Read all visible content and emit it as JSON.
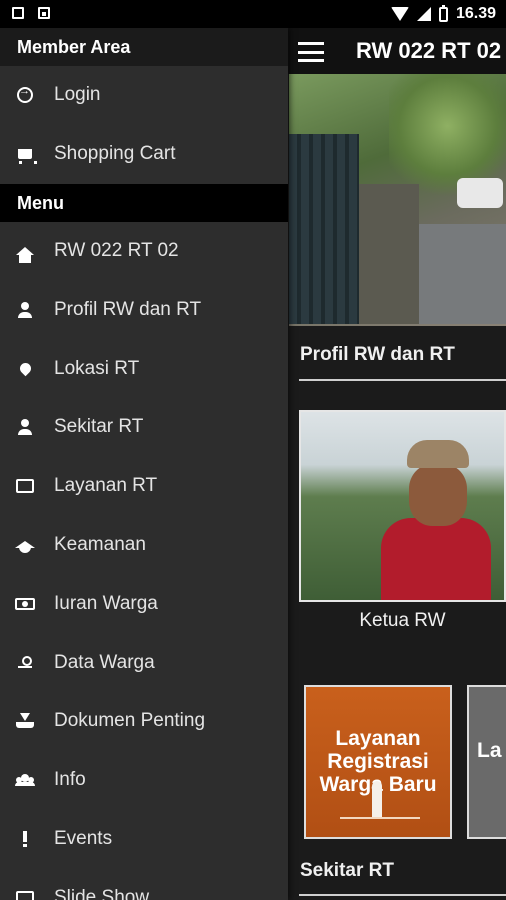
{
  "status_bar": {
    "time": "16.39"
  },
  "toolbar": {
    "title": "RW 022 RT 02"
  },
  "drawer": {
    "member_header": "Member Area",
    "member_items": [
      {
        "label": "Login",
        "icon": "login-icon"
      },
      {
        "label": "Shopping Cart",
        "icon": "cart-icon"
      }
    ],
    "menu_header": "Menu",
    "menu_items": [
      {
        "label": "RW 022 RT 02",
        "icon": "home-icon"
      },
      {
        "label": "Profil RW dan RT",
        "icon": "person-icon"
      },
      {
        "label": "Lokasi RT",
        "icon": "location-pin-icon"
      },
      {
        "label": "Sekitar RT",
        "icon": "person-icon"
      },
      {
        "label": "Layanan RT",
        "icon": "folder-icon"
      },
      {
        "label": "Keamanan",
        "icon": "graduation-cap-icon"
      },
      {
        "label": "Iuran Warga",
        "icon": "money-icon"
      },
      {
        "label": "Data Warga",
        "icon": "contact-icon"
      },
      {
        "label": "Dokumen Penting",
        "icon": "download-icon"
      },
      {
        "label": "Info",
        "icon": "group-icon"
      },
      {
        "label": "Events",
        "icon": "exclamation-icon"
      },
      {
        "label": "Slide Show",
        "icon": "slides-icon"
      }
    ]
  },
  "content": {
    "section_profile": "Profil RW dan RT",
    "photo_caption": "Ketua RW",
    "promo_a_text": "Layanan\nRegistrasi\nWarga Baru",
    "promo_b_text": "La",
    "section_sekitar": "Sekitar RT"
  }
}
